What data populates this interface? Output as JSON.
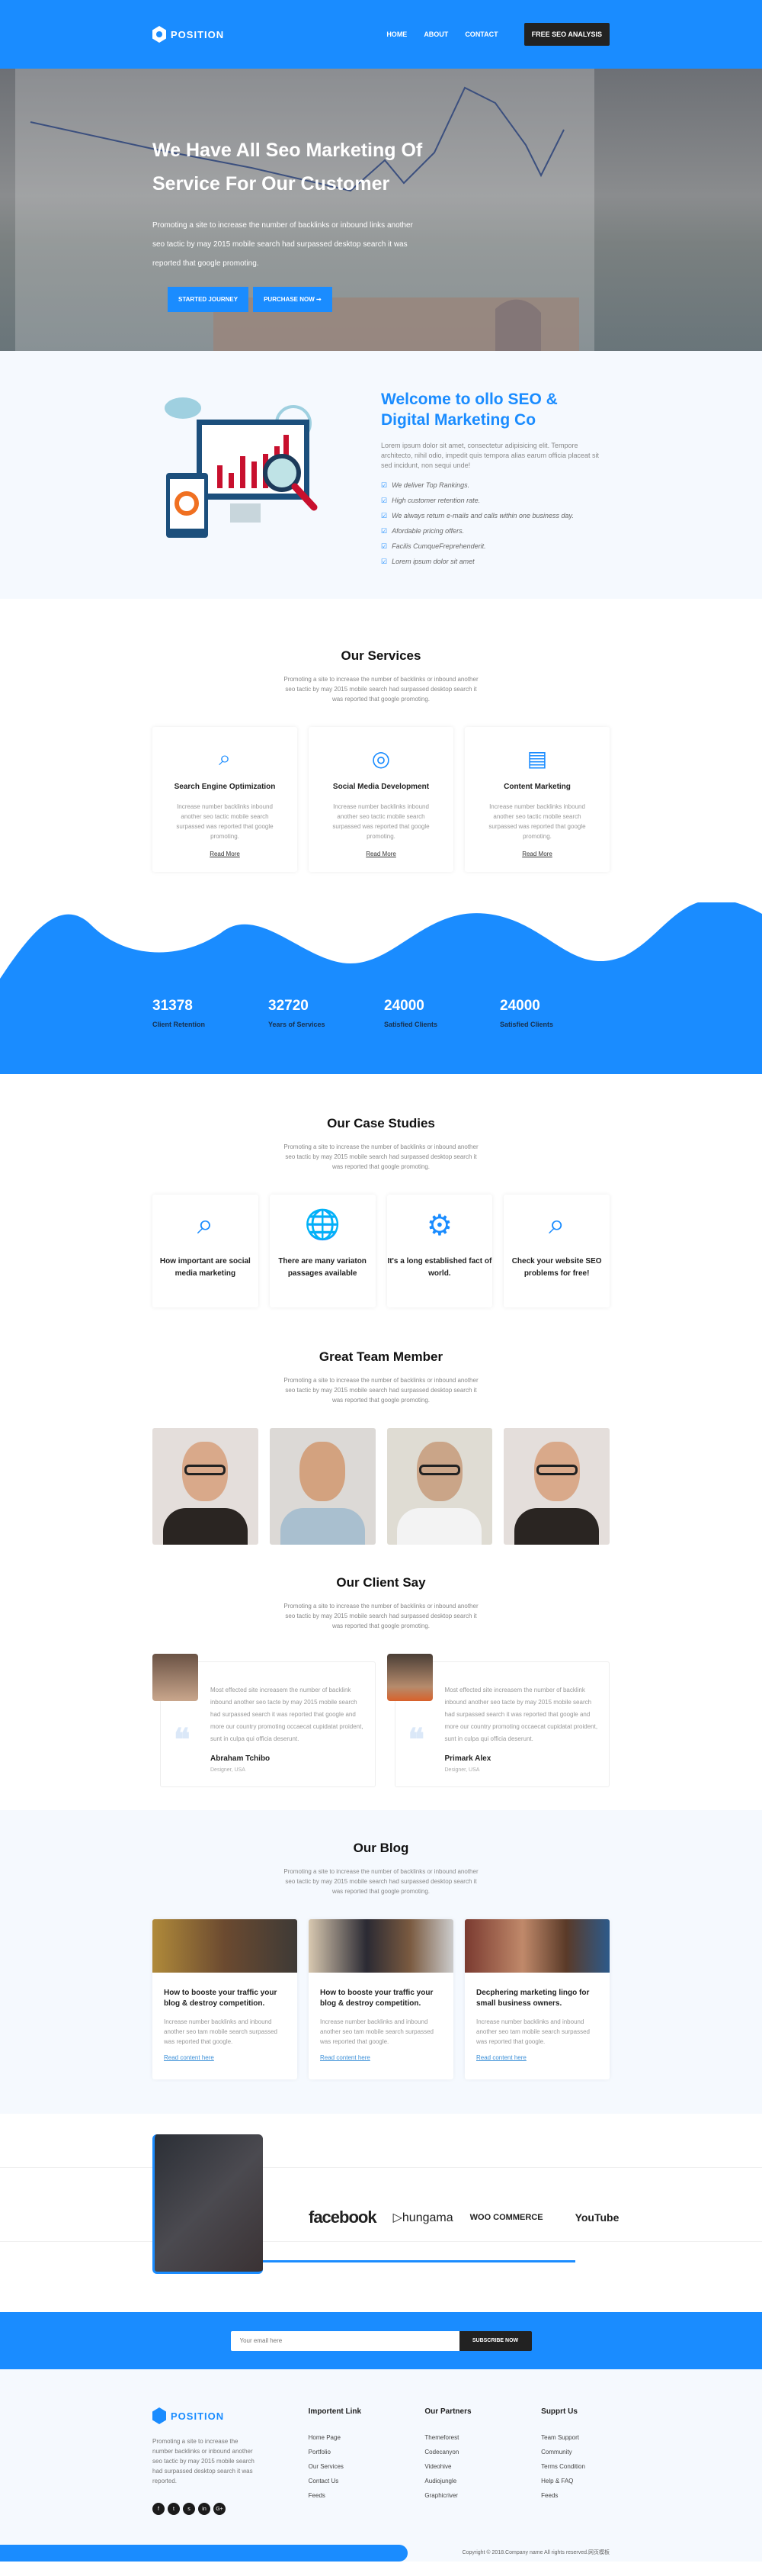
{
  "brand": {
    "name": "POSITION",
    "accent": "#1a8cff",
    "dark": "#222222"
  },
  "nav": {
    "items": [
      "HOME",
      "ABOUT",
      "CONTACT"
    ],
    "cta": "FREE SEO ANALYSIS"
  },
  "hero": {
    "title": "We Have All Seo Marketing Of Service For Our Customer",
    "text": "Promoting a site to increase the number of backlinks or inbound links another seo tactic by may 2015 mobile search had surpassed desktop search it was reported that google promoting.",
    "btn1": "STARTED JOURNEY",
    "btn2": "PURCHASE NOW ➞"
  },
  "about": {
    "title": "Welcome to ollo SEO & Digital Marketing Co",
    "text": "Lorem ipsum dolor sit amet, consectetur adipisicing elit. Tempore architecto, nihil odio, impedit quis tempora alias earum officia placeat sit sed incidunt, non sequi unde!",
    "list": [
      "We deliver Top Rankings.",
      "High customer retention rate.",
      "We always return e-mails and calls within one business day.",
      "Afordable pricing offers.",
      "Facilis CumqueFreprehenderit.",
      "Lorem ipsum dolor sit amet"
    ]
  },
  "section_sub": "Promoting a site to increase the number of backlinks or inbound another seo tactic by may 2015 mobile search had surpassed desktop search it was reported that google promoting.",
  "services": {
    "title": "Our Services",
    "items": [
      {
        "icon": "seo-icon",
        "title": "Search Engine Optimization",
        "text": "Increase number backlinks inbound another seo tactic mobile search surpassed was reported that google promoting.",
        "link": "Read More"
      },
      {
        "icon": "instagram-icon",
        "title": "Social Media Development",
        "text": "Increase number backlinks inbound another seo tactic mobile search surpassed was reported that google promoting.",
        "link": "Read More"
      },
      {
        "icon": "clipboard-icon",
        "title": "Content Marketing",
        "text": "Increase number backlinks inbound another seo tactic mobile search surpassed was reported that google promoting.",
        "link": "Read More"
      }
    ]
  },
  "stats": [
    {
      "value": "31378",
      "label": "Client Retention"
    },
    {
      "value": "32720",
      "label": "Years of Services"
    },
    {
      "value": "24000",
      "label": "Satisfied Clients"
    },
    {
      "value": "24000",
      "label": "Satisfied Clients"
    }
  ],
  "cases": {
    "title": "Our Case Studies",
    "items": [
      "How important are social media marketing",
      "There are many variaton passages available",
      "It's a long established fact of world.",
      "Check your website SEO problems for free!"
    ]
  },
  "team": {
    "title": "Great Team Member"
  },
  "clients": {
    "title": "Our Client Say",
    "items": [
      {
        "text": "Most effected site increasem the number of backlink inbound another seo tacte by may 2015 mobile search had surpassed search it was reported that google and more our country promoting occaecat cupidatat proident, sunt in culpa qui officia deserunt.",
        "name": "Abraham Tchibo",
        "role": "Designer, USA"
      },
      {
        "text": "Most effected site increasem the number of backlink inbound another seo tacte by may 2015 mobile search had surpassed search it was reported that google and more our country promoting occaecat cupidatat proident, sunt in culpa qui officia deserunt.",
        "name": "Primark Alex",
        "role": "Designer, USA"
      }
    ]
  },
  "blog": {
    "title": "Our Blog",
    "items": [
      {
        "title": "How to booste your traffic your blog & destroy competition.",
        "text": "Increase number backlinks and inbound another seo tam mobile search surpassed was reported that google.",
        "link": "Read content here"
      },
      {
        "title": "How to booste your traffic your blog & destroy competition.",
        "text": "Increase number backlinks and inbound another seo tam mobile search surpassed was reported that google.",
        "link": "Read content here"
      },
      {
        "title": "Decphering marketing lingo for small business owners.",
        "text": "Increase number backlinks and inbound another seo tam mobile search surpassed was reported that google.",
        "link": "Read content here"
      }
    ]
  },
  "partners_logos": [
    "facebook",
    "hungama",
    "WOO COMMERCE",
    "YouTube"
  ],
  "subscribe": {
    "placeholder": "Your email here",
    "button": "SUBSCRIBE NOW"
  },
  "footer": {
    "about": "Promoting a site to increase the number backlinks or inbound another seo tactic by may 2015 mobile search had surpassed desktop search it was reported.",
    "social": [
      "f",
      "t",
      "s",
      "in",
      "G+"
    ],
    "cols": [
      {
        "title": "Importent Link",
        "links": [
          "Home Page",
          "Portfolio",
          "Our Services",
          "Contact Us",
          "Feeds"
        ]
      },
      {
        "title": "Our Partners",
        "links": [
          "Themeforest",
          "Codecanyon",
          "Videohive",
          "Audiojungle",
          "Graphicriver"
        ]
      },
      {
        "title": "Supprt Us",
        "links": [
          "Team Support",
          "Community",
          "Terms Condition",
          "Help & FAQ",
          "Feeds"
        ]
      }
    ],
    "copyright": "Copyright © 2018.Company name All rights reserved.网页模板"
  }
}
